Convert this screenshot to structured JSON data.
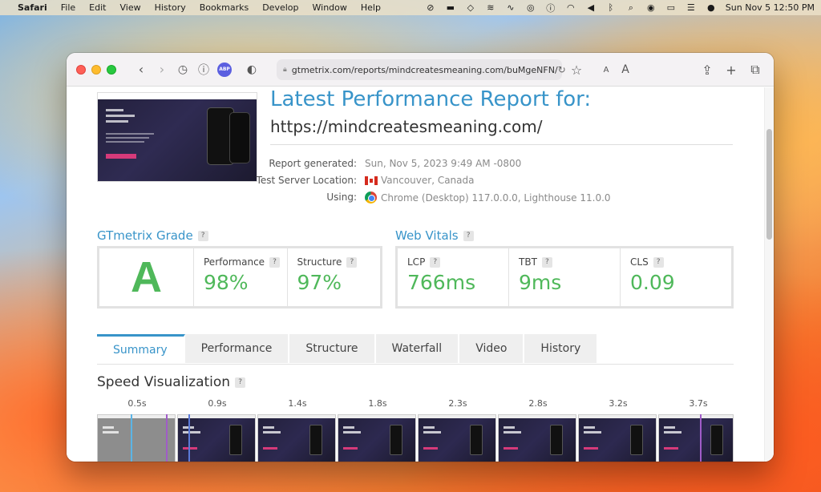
{
  "menubar": {
    "items": [
      "Safari",
      "File",
      "Edit",
      "View",
      "History",
      "Bookmarks",
      "Develop",
      "Window",
      "Help"
    ],
    "clock": "Sun Nov 5  12:50 PM"
  },
  "browser": {
    "url": "gtmetrix.com/reports/mindcreatesmeaning.com/buMgeNFN/",
    "abp_label": "ABP",
    "font_small": "A",
    "font_large": "A"
  },
  "report": {
    "title": "Latest Performance Report for:",
    "url": "https://mindcreatesmeaning.com/",
    "generated_label": "Report generated:",
    "generated_value": "Sun, Nov 5, 2023 9:49 AM -0800",
    "server_label": "Test Server Location:",
    "server_value": "Vancouver, Canada",
    "using_label": "Using:",
    "using_value": "Chrome (Desktop) 117.0.0.0, Lighthouse 11.0.0"
  },
  "grade": {
    "section_title": "GTmetrix Grade",
    "letter": "A",
    "performance_label": "Performance",
    "performance_value": "98%",
    "structure_label": "Structure",
    "structure_value": "97%"
  },
  "vitals": {
    "section_title": "Web Vitals",
    "lcp_label": "LCP",
    "lcp_value": "766ms",
    "tbt_label": "TBT",
    "tbt_value": "9ms",
    "cls_label": "CLS",
    "cls_value": "0.09"
  },
  "help_mark": "?",
  "tabs": [
    "Summary",
    "Performance",
    "Structure",
    "Waterfall",
    "Video",
    "History"
  ],
  "active_tab": "Summary",
  "speed": {
    "title": "Speed Visualization",
    "ticks": [
      "0.5s",
      "0.9s",
      "1.4s",
      "1.8s",
      "2.3s",
      "2.8s",
      "3.2s",
      "3.7s"
    ]
  },
  "colors": {
    "accent": "#3894c9",
    "grade_green": "#4fb85a"
  }
}
